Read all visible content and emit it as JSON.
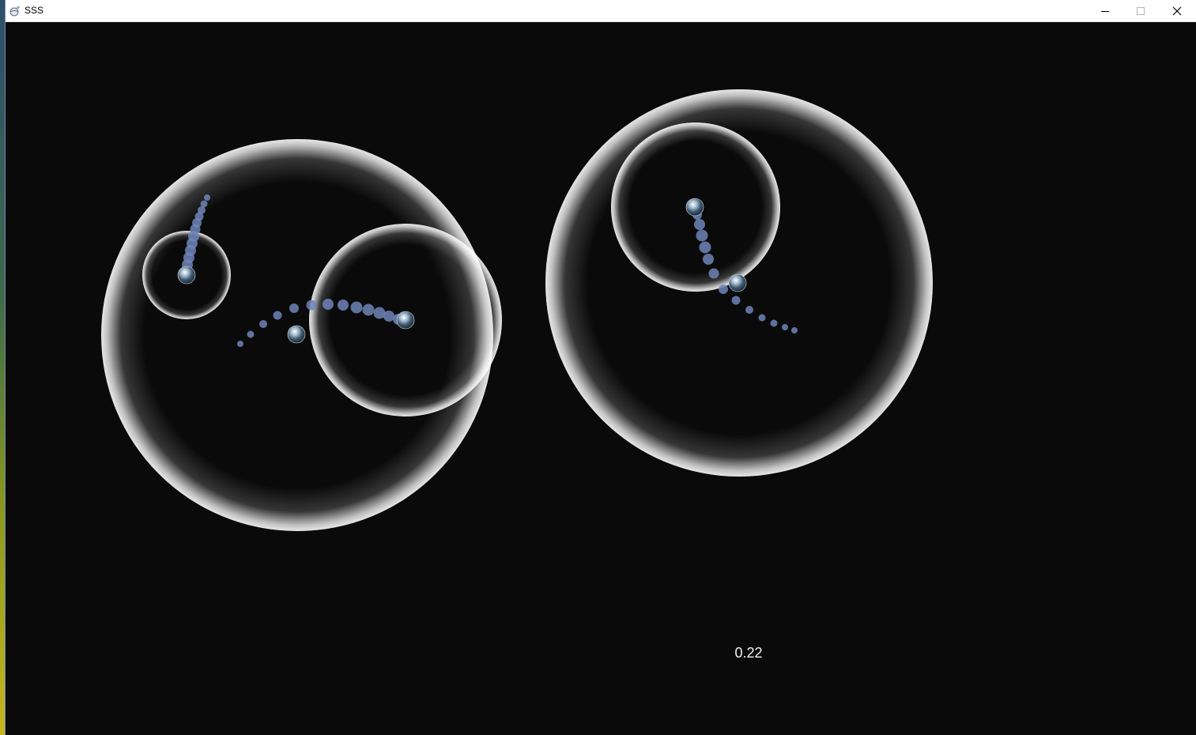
{
  "window": {
    "title": "SSS",
    "app_icon": "planet-app-icon",
    "controls": {
      "minimize_icon": "minimize-icon",
      "maximize_icon": "maximize-icon",
      "close_icon": "close-icon"
    }
  },
  "simulation": {
    "readout": "0.22",
    "colors": {
      "background": "#0a0a0a",
      "orbit_ring": "#ffffff",
      "trail": "#6f85b8"
    },
    "icons": {
      "planet": "earth-planet-icon",
      "orbit": "orbit-bubble-icon",
      "trail": "motion-trail-dot-icon"
    }
  }
}
